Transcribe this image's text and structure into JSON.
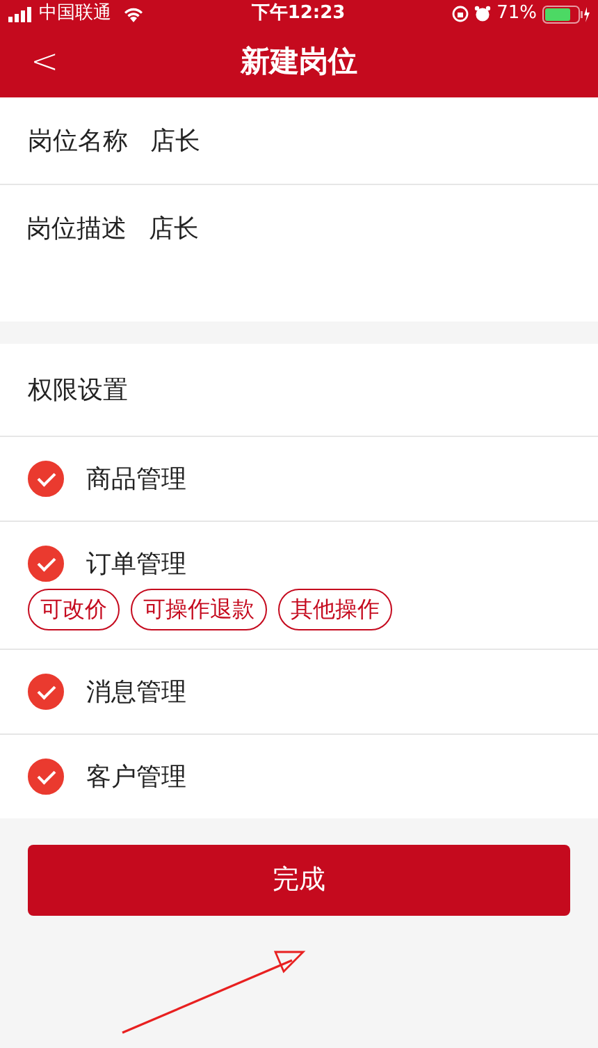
{
  "status_bar": {
    "carrier": "中国联通",
    "time": "下午12:23",
    "battery": "71%"
  },
  "nav": {
    "back": "<",
    "title": "新建岗位"
  },
  "fields": [
    {
      "label": "岗位名称",
      "value": "店长"
    },
    {
      "label": "岗位描述",
      "value": "店长"
    }
  ],
  "permissions": {
    "title": "权限设置",
    "items": [
      {
        "label": "商品管理",
        "checked": true
      },
      {
        "label": "订单管理",
        "checked": true,
        "tags": [
          "可改价",
          "可操作退款",
          "其他操作"
        ]
      },
      {
        "label": "消息管理",
        "checked": true
      },
      {
        "label": "客户管理",
        "checked": true
      }
    ]
  },
  "submit": "完成"
}
